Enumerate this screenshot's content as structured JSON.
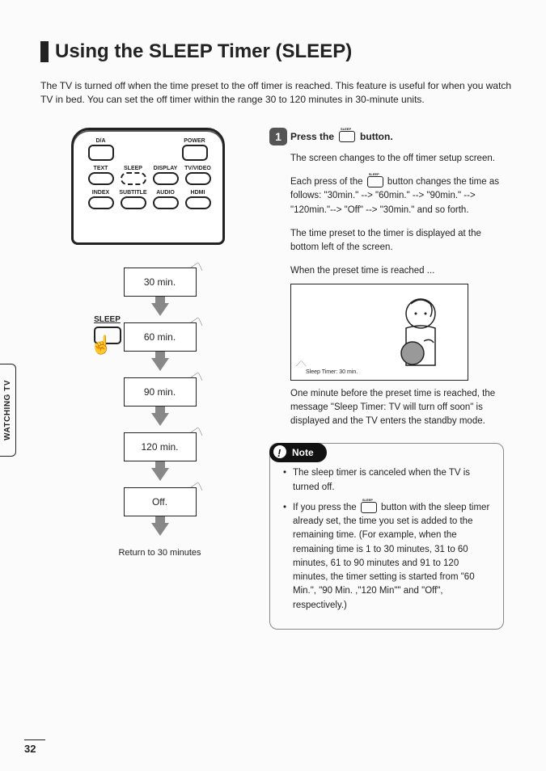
{
  "title": "Using the SLEEP Timer (SLEEP)",
  "intro": "The TV is turned off when the time preset to the off timer is reached. This feature is useful for when you watch TV in bed. You can set the off timer within the range 30 to 120 minutes in 30-minute units.",
  "side_tab": "WATCHING TV",
  "page_number": "32",
  "remote": {
    "row1": [
      "D/A",
      "POWER"
    ],
    "row2": [
      "TEXT",
      "SLEEP",
      "DISPLAY",
      "TV/VIDEO"
    ],
    "row3": [
      "INDEX",
      "SUBTITLE",
      "AUDIO",
      "HDMI"
    ]
  },
  "sleep_label": "SLEEP",
  "flow": {
    "times": [
      "30 min.",
      "60 min.",
      "90 min.",
      "120 min.",
      "Off."
    ],
    "return_text": "Return to 30 minutes"
  },
  "step": {
    "number": "1",
    "head_before": "Press the",
    "head_after": "button.",
    "p1": "The screen changes to the off timer setup screen.",
    "p2_before": "Each press of the",
    "p2_after": "button changes the time as follows: \"30min.\" --> \"60min.\" --> \"90min.\" --> \"120min.\"--> \"Off\" --> \"30min.\" and so forth.",
    "p3": "The time preset to the timer is displayed at the bottom left of the screen.",
    "p4": "When the preset time is reached ...",
    "ill_caption": "Sleep Timer: 30 min.",
    "p5": "One minute before the preset time is reached, the message \"Sleep Timer: TV will turn off soon\" is displayed and the TV enters the standby mode."
  },
  "note": {
    "label": "Note",
    "item1": "The sleep timer is canceled when the TV is turned off.",
    "item2_before": "If you press the",
    "item2_after": "button with the sleep timer already set, the time you set is added to the remaining time. (For example, when the remaining time is 1 to 30 minutes, 31 to 60 minutes, 61 to 90 minutes and 91 to 120 minutes, the timer setting is started from \"60 Min.\", \"90 Min. ,\"120 Min\"\" and \"Off\", respectively.)"
  }
}
